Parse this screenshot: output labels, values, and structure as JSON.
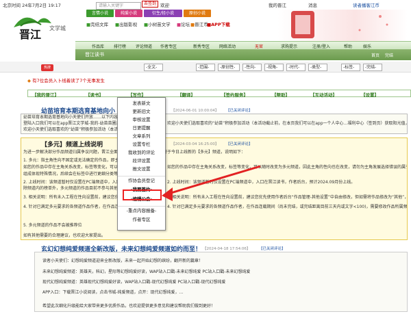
{
  "topbar": {
    "time": "北京时间 24年7月2日 19:17",
    "register": "去签到",
    "welcome": "欢迎",
    "home": "我的晋江",
    "messages": "消息",
    "help_link": "读者播客江币"
  },
  "header": {
    "logo_text": "晋江",
    "logo_sub": "文学城",
    "channels": [
      "言情小说",
      "纯爱小说",
      "衍生/轻小说",
      "原创小说"
    ],
    "services": [
      "完结文库",
      "出版影视",
      "小树苗文学",
      "论坛",
      "晋江币",
      "APP下载"
    ]
  },
  "nav1": {
    "items": [
      "作品库",
      "排行榜",
      "评论频道",
      "作者专区",
      "新秀专区",
      "网络活动",
      "无官",
      "求购提示",
      "注册/登入",
      "帮助",
      "娱乐"
    ]
  },
  "nav2": {
    "title": "晋江读书",
    "right": [
      "首页",
      "完结"
    ]
  },
  "search": {
    "placeholder": "请输入关键字",
    "hot": "热搜",
    "filters": [
      "-全文-",
      "-范围-",
      "-原创性-",
      "-性向-",
      "-视角-",
      "-时代-",
      "-类型-",
      "-标签-",
      "-完结-"
    ]
  },
  "notice": {
    "text_red": "有7位会员入卜线着读了",
    "text_mid": "7个无事发生",
    "text_black": "了"
  },
  "menubar": {
    "items": [
      "【我的晋江】",
      "【读书】",
      "【写作】",
      "【翻译】",
      "【签约服务】",
      "【帮助】",
      "【互动活动】",
      "【设置】"
    ]
  },
  "dropdown": {
    "items": [
      "发表新文",
      "更新旧文",
      "审核设置",
      "日更提醒",
      "文章系列",
      "设置专栏",
      "我收到的评论",
      "段评设置",
      "推文设置",
      "作协会员登记",
      "-我要签约-",
      "-编辑公会-",
      "-重点内容报备-",
      "作者专区"
    ]
  },
  "articles": [
    {
      "title": "幼苗培育本期选育基地向小",
      "date": "【2024-06-01 10:00:04】",
      "closed": "【已关闭评论】",
      "lines": [
        "幼苗培育本期选育基地向小天使们开放……以下内容主要面对幼苗作者 本期“幼苗”作品。",
        "登陆入口我们可以在app晋江文学城-我的-幼苗苗圃基地，或点击链接进入",
        "欢迎小天使们选取喜欢的“幼苗”积极参加活动（本活动截止前，在本页我们可以在app一个人中心…福利中心（签到页）获取阳光值，还有机会获得完这个已经了。"
      ]
    },
    {
      "title": "【多元】频道上线说明",
      "date": "【2024-03-04 16:25:00】",
      "closed": "【已关闭评论】",
      "lines": [
        "为进一步解决部分作品频道归属争议问题，晋江全面上线【多元】频道，网站将于今日上线新的【多元】频道，说明如下：",
        "1. 多元：指主角性向不固定或无法确定的作品，即主角不明确…请将全部的以及其他不属于言的作品。",
        "如您的作品中存在主角关系改变，标签等变化，可以随时改变为多元频道，因此主角的性向也在改变，请勿为主角发展选择错误的属于多元频道；针对主角性向为双性恋且双向情感均有详细展开，文中包含多种性向",
        "组成体现特殊情况，后续会在标签中进行更细分类等。",
        "2. 上线时间：该频道暂时仅设置在PC端频道中，入口在晋江读书，作者后台，预计2024.09月份上线。",
        "除频道内的榜单外，多元频道的作品目前不参与其他频道的，对于其他频道的作品只会在现有的标签中按实际情况来进行标签操作。",
        "3. 相关说明：所有未入工程在性向设置前，建议您优先使用作者后台“作品管理-其他设置”中自由修改，但如需将作品修改为“其他”，将作品修改为多元频道，此类作品将免收申请人的处罚。",
        "4. 针对已满足多元要求的各频道作品作者，在作品连载期间（尚未完结，或完结距离目前三天内或文字<100)，需要修改作品所属频道，需按照要求提交修改申请，完结三天内或文字<100，已完成作品：发文三天内且文字<100）以外，多元频道的作品不支持自行修改所属频道",
        "5. 多元频道的作品不会被推荐位",
        "如有其他需要的合理建议，也欢迎大家提出。"
      ]
    },
    {
      "title": "玄幻幻想纯爱频道全新改版，未来幻想纯爱频道如约而至！",
      "date": "【2024-04-18 17:54:06】",
      "closed": "【已关闭评论】",
      "lines": [
        "读者小天使们：幻想纯爱频道迎来全新改版，未来一起开始幻想的缤纷，翻开新的篇章！",
        "未来幻想纯爱频道：英雄天，科幻，星际等幻想纯爱好读，WAP站入口戳-未来幻想纯爱 PC站入口戳-未来幻想纯爱",
        "现代幻想纯爱频道：英雄现代幻想纯爱好读，WAP站入口戳-现代幻想纯爱 PC站入口戳-现代幻想纯爱",
        "APP入口：下载晋江小说阅读，点击书城-纯爱频道，点开：现代幻想纯爱，…",
        "希望此次细化升级能给大家带来更多优质作品，也欢迎提供更多意见和建议帮助我们做到更好！"
      ]
    }
  ],
  "colors": {
    "accent_green": "#3c9a2e",
    "link_blue": "#1a4fa0",
    "highlight_red": "#e22222"
  }
}
